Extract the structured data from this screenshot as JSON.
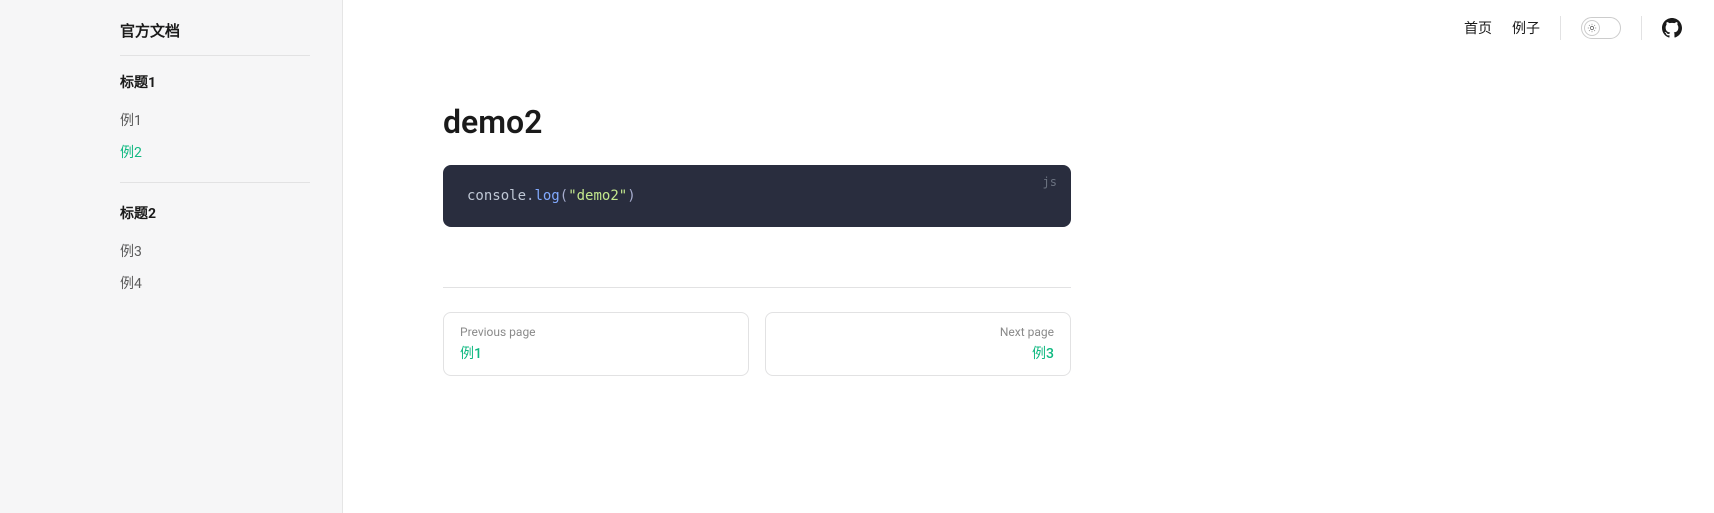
{
  "sidebar": {
    "title": "官方文档",
    "groups": [
      {
        "title": "标题1",
        "items": [
          {
            "label": "例1",
            "active": false
          },
          {
            "label": "例2",
            "active": true
          }
        ]
      },
      {
        "title": "标题2",
        "items": [
          {
            "label": "例3",
            "active": false
          },
          {
            "label": "例4",
            "active": false
          }
        ]
      }
    ]
  },
  "header": {
    "nav": [
      {
        "label": "首页"
      },
      {
        "label": "例子"
      }
    ]
  },
  "page": {
    "title": "demo2",
    "code": {
      "lang": "js",
      "tokens": {
        "obj": "console",
        "dot": ".",
        "method": "log",
        "open": "(",
        "str": "\"demo2\"",
        "close": ")"
      }
    }
  },
  "footer": {
    "prev": {
      "label": "Previous page",
      "title": "例1"
    },
    "next": {
      "label": "Next page",
      "title": "例3"
    }
  }
}
